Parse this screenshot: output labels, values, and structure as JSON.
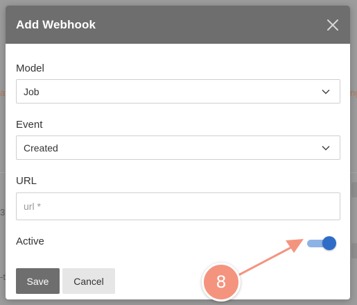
{
  "background": {
    "fragments": [
      "at",
      "ng",
      "a",
      "3",
      "a",
      "-t"
    ]
  },
  "modal": {
    "title": "Add Webhook",
    "close_icon": "close-icon"
  },
  "form": {
    "model": {
      "label": "Model",
      "value": "Job"
    },
    "event": {
      "label": "Event",
      "value": "Created"
    },
    "url": {
      "label": "URL",
      "value": "",
      "placeholder": "url *"
    },
    "active": {
      "label": "Active",
      "checked": true
    }
  },
  "buttons": {
    "save_label": "Save",
    "cancel_label": "Cancel"
  },
  "annotation": {
    "step_number": "8"
  },
  "colors": {
    "header": "#6e6e6e",
    "toggle_on": "#2f6cc8",
    "annotation": "#f4947f"
  }
}
